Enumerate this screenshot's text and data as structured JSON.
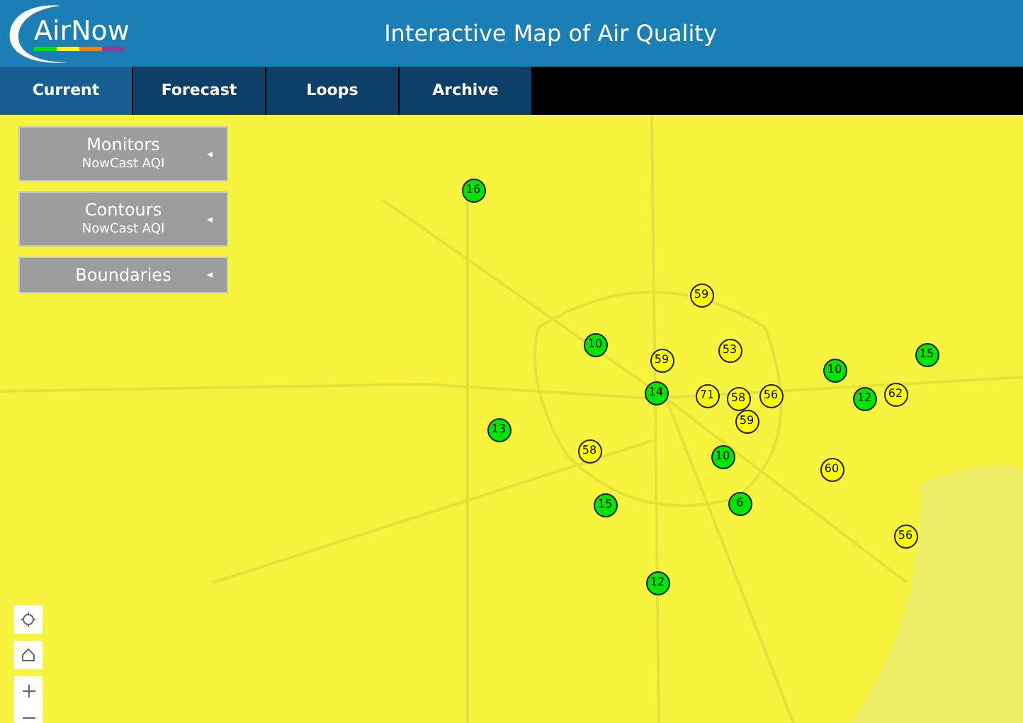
{
  "header": {
    "logo": "AirNow",
    "title": "Interactive Map of Air Quality"
  },
  "tabs": [
    {
      "label": "Current",
      "selected": true
    },
    {
      "label": "Forecast",
      "selected": false
    },
    {
      "label": "Loops",
      "selected": false
    },
    {
      "label": "Archive",
      "selected": false
    }
  ],
  "layers": [
    {
      "title": "Monitors",
      "subtitle": "NowCast AQI"
    },
    {
      "title": "Contours",
      "subtitle": "NowCast AQI"
    },
    {
      "title": "Boundaries"
    }
  ],
  "monitors": [
    {
      "value": "16",
      "color": "#00e400"
    },
    {
      "value": "59",
      "color": "#ffff00"
    },
    {
      "value": "10",
      "color": "#00e400"
    },
    {
      "value": "59",
      "color": "#ffff00"
    },
    {
      "value": "53",
      "color": "#ffff00"
    },
    {
      "value": "10",
      "color": "#00e400"
    },
    {
      "value": "15",
      "color": "#00e400"
    },
    {
      "value": "14",
      "color": "#00e400"
    },
    {
      "value": "71",
      "color": "#ffff00"
    },
    {
      "value": "58",
      "color": "#ffff00"
    },
    {
      "value": "56",
      "color": "#ffff00"
    },
    {
      "value": "12",
      "color": "#00e400"
    },
    {
      "value": "62",
      "color": "#ffff00"
    },
    {
      "value": "59",
      "color": "#ffff00"
    },
    {
      "value": "13",
      "color": "#00e400"
    },
    {
      "value": "58",
      "color": "#ffff00"
    },
    {
      "value": "10",
      "color": "#00e400"
    },
    {
      "value": "60",
      "color": "#ffff00"
    },
    {
      "value": "15",
      "color": "#00e400"
    },
    {
      "value": "6",
      "color": "#00e400"
    },
    {
      "value": "56",
      "color": "#ffff00"
    },
    {
      "value": "12",
      "color": "#00e400"
    }
  ]
}
